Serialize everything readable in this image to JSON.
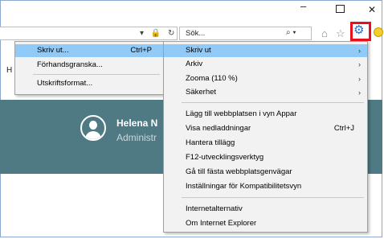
{
  "window": {
    "min_glyph": "–",
    "close_glyph": "✕"
  },
  "toolbar": {
    "addr_icons": "▾ 🔒 ↻",
    "search_placeholder": "Sök...",
    "search_icon": "⌕ ▾",
    "home_icon": "⌂",
    "star_icon": "☆",
    "gear_icon": "⚙"
  },
  "page": {
    "heading": "H",
    "user_name": "Helena N",
    "user_role": "Administr"
  },
  "print_menu": {
    "items": [
      {
        "label": "Skriv ut...",
        "shortcut": "Ctrl+P"
      },
      {
        "label": "Förhandsgranska...",
        "shortcut": ""
      },
      {
        "label": "Utskriftsformat...",
        "shortcut": ""
      }
    ]
  },
  "tools_menu": {
    "items": [
      {
        "label": "Skriv ut",
        "arrow": "›"
      },
      {
        "label": "Arkiv",
        "arrow": "›"
      },
      {
        "label": "Zooma (110 %)",
        "arrow": "›"
      },
      {
        "label": "Säkerhet",
        "arrow": "›"
      },
      {
        "label": "Lägg till webbplatsen i vyn Appar"
      },
      {
        "label": "Visa nedladdningar",
        "shortcut": "Ctrl+J"
      },
      {
        "label": "Hantera tillägg"
      },
      {
        "label": "F12-utvecklingsverktyg"
      },
      {
        "label": "Gå till fästa webbplatsgenvägar"
      },
      {
        "label": "Inställningar för Kompatibilitetsvyn"
      },
      {
        "label": "Internetalternativ"
      },
      {
        "label": "Om Internet Explorer"
      }
    ]
  },
  "colors": {
    "accent": "#91c9f7",
    "banner": "#4f7a84",
    "highlight_box": "#e8101a",
    "gear": "#1a6fd4"
  }
}
